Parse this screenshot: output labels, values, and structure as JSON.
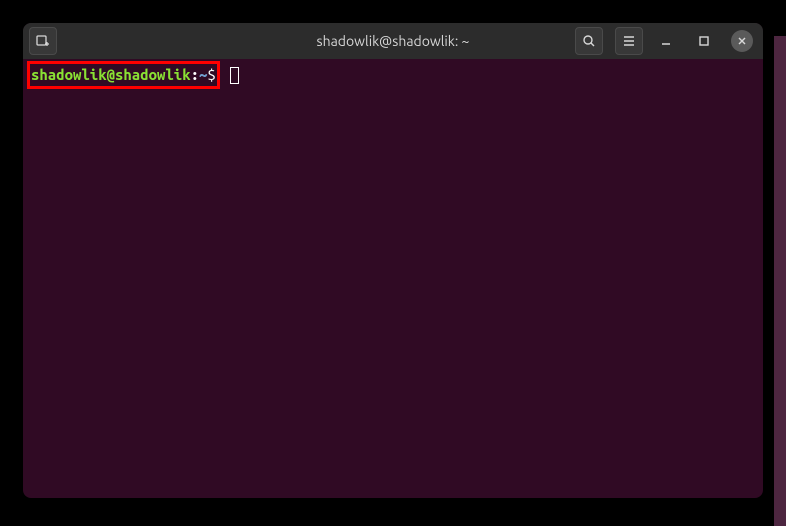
{
  "window": {
    "title": "shadowlik@shadowlik: ~"
  },
  "terminal": {
    "prompt_user_host": "shadowlik@shadowlik",
    "prompt_colon": ":",
    "prompt_path": "~",
    "prompt_symbol": "$"
  },
  "colors": {
    "background": "#300a24",
    "prompt_user": "#8ae234",
    "prompt_path": "#729fcf",
    "highlight_border": "#ff0000"
  }
}
